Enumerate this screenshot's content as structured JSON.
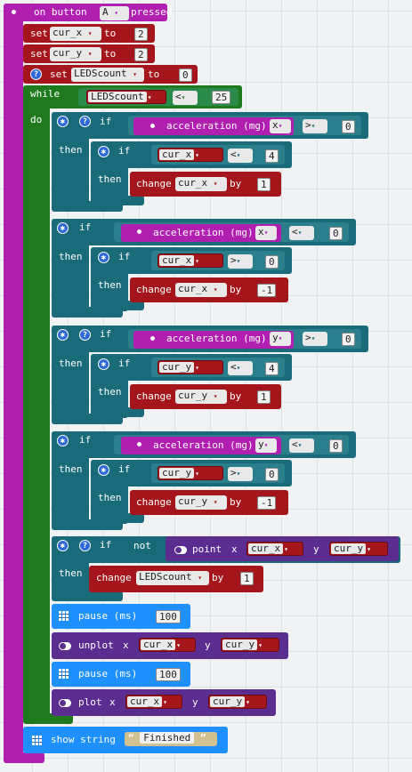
{
  "colors": {
    "event": "#b01fb0",
    "var": "#a4161b",
    "loop": "#1f7a1f",
    "logic": "#1a6b79",
    "led": "#5c2d91",
    "basic": "#1e90ff",
    "text": "#d2c190"
  },
  "event": {
    "label": "on button",
    "button": "A",
    "suffix": "pressed"
  },
  "set1": {
    "kw": "set",
    "var": "cur_x",
    "to": "to",
    "value": "2"
  },
  "set2": {
    "kw": "set",
    "var": "cur_y",
    "to": "to",
    "value": "2"
  },
  "set3": {
    "kw": "set",
    "var": "LEDScount",
    "to": "to",
    "value": "0"
  },
  "while": {
    "kw": "while",
    "do": "do",
    "var": "LEDScount",
    "op": "<",
    "value": "25"
  },
  "if1": {
    "kw": "if",
    "then": "then",
    "sensor": "acceleration (mg)",
    "axis": "x",
    "op": ">",
    "value": "0",
    "inner_if": "if",
    "inner_var": "cur_x",
    "inner_op": "<",
    "inner_val": "4",
    "inner_then": "then",
    "change": "change",
    "change_var": "cur_x",
    "by": "by",
    "by_val": "1"
  },
  "if2": {
    "kw": "if",
    "then": "then",
    "sensor": "acceleration (mg)",
    "axis": "x",
    "op": "<",
    "value": "0",
    "inner_if": "if",
    "inner_var": "cur_x",
    "inner_op": ">",
    "inner_val": "0",
    "inner_then": "then",
    "change": "change",
    "change_var": "cur_x",
    "by": "by",
    "by_val": "-1"
  },
  "if3": {
    "kw": "if",
    "then": "then",
    "sensor": "acceleration (mg)",
    "axis": "y",
    "op": ">",
    "value": "0",
    "inner_if": "if",
    "inner_var": "cur_y",
    "inner_op": "<",
    "inner_val": "4",
    "inner_then": "then",
    "change": "change",
    "change_var": "cur_y",
    "by": "by",
    "by_val": "1"
  },
  "if4": {
    "kw": "if",
    "then": "then",
    "sensor": "acceleration (mg)",
    "axis": "y",
    "op": "<",
    "value": "0",
    "inner_if": "if",
    "inner_var": "cur_y",
    "inner_op": ">",
    "inner_val": "0",
    "inner_then": "then",
    "change": "change",
    "change_var": "cur_y",
    "by": "by",
    "by_val": "-1"
  },
  "if5": {
    "kw": "if",
    "not": "not",
    "point": "point",
    "x": "x",
    "xvar": "cur_x",
    "y": "y",
    "yvar": "cur_y",
    "then": "then",
    "change": "change",
    "change_var": "LEDScount",
    "by": "by",
    "by_val": "1"
  },
  "pause1": {
    "label": "pause (ms)",
    "value": "100"
  },
  "unplot": {
    "label": "unplot",
    "x": "x",
    "xvar": "cur_x",
    "y": "y",
    "yvar": "cur_y"
  },
  "pause2": {
    "label": "pause (ms)",
    "value": "100"
  },
  "plot": {
    "label": "plot",
    "x": "x",
    "xvar": "cur_x",
    "y": "y",
    "yvar": "cur_y"
  },
  "show": {
    "label": "show string",
    "open_quote": "“",
    "value": "Finished",
    "close_quote": "”"
  },
  "arrow": "▾"
}
